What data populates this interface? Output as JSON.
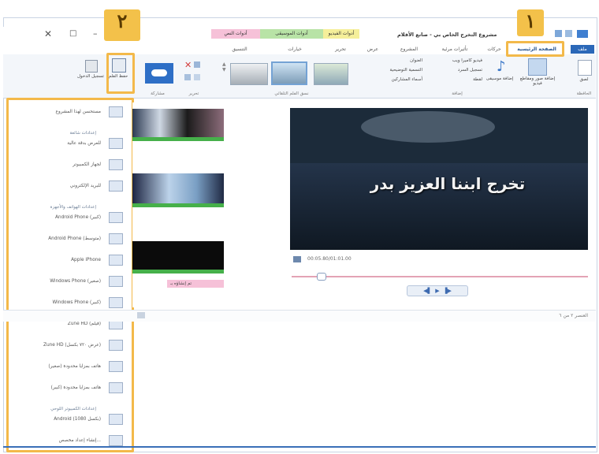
{
  "window": {
    "title": "مشروع التخرج الخاص بي - صانع الأفلام",
    "controls": [
      "x",
      "□",
      "-"
    ]
  },
  "ribbon_tabs": [
    "ملف",
    "الصفحة الرئيسية",
    "حركات",
    "تأثيرات مرئية",
    "المشروع",
    "عرض",
    "تحرير",
    "خيارات",
    "التنسيق"
  ],
  "context_tabs": [
    "أدوات الفيديو",
    "أدوات الموسيقى",
    "أدوات النص"
  ],
  "ribbon": {
    "paste_label": "لصق",
    "add_video_label": "إضافة صور ومقاطع فيديو",
    "add_music_label": "إضافة موسيقى",
    "webcam_label": "فيديو كاميرا ويب",
    "narration_label": "تسجيل السرد",
    "snapshot_label": "لقطة",
    "title_label": "العنوان",
    "caption_label": "التسمية التوضيحية",
    "credits_label": "أسماء المشاركين",
    "save_movie_label": "حفظ الفلم",
    "sign_in_label": "تسجيل الدخول",
    "groups": {
      "clipboard": "الحافظة",
      "add": "إضافة",
      "themes": "نسق الفلم التلقائي",
      "edit": "تحرير",
      "share": "مشاركة"
    }
  },
  "annotations": {
    "badge_1": "١",
    "badge_2": "٢"
  },
  "save_menu": {
    "items": [
      {
        "type": "item",
        "label": "مستحسن لهذا المشروع"
      },
      {
        "type": "heading",
        "label": "إعدادات شائعة"
      },
      {
        "type": "item",
        "label": "للعرض بدقة عالية"
      },
      {
        "type": "item",
        "label": "لجهاز الكمبيوتر"
      },
      {
        "type": "item",
        "label": "للبريد الإلكتروني"
      },
      {
        "type": "heading",
        "label": "إعدادات الهواتف والأجهزة"
      },
      {
        "type": "item",
        "label": "Android Phone (كبير)"
      },
      {
        "type": "item",
        "label": "Android Phone (متوسط)"
      },
      {
        "type": "item",
        "label": "Apple iPhone"
      },
      {
        "type": "item",
        "label": "Windows Phone (صغير)"
      },
      {
        "type": "item",
        "label": "Windows Phone (كبير)"
      },
      {
        "type": "item",
        "label": "Zune HD (فيلم)"
      },
      {
        "type": "item",
        "label": "Zune HD (عرض ٧٢٠ بكسل)"
      },
      {
        "type": "item",
        "label": "هاتف بمزايا محدودة (صغير)"
      },
      {
        "type": "item",
        "label": "هاتف بمزايا محدودة (كبير)"
      },
      {
        "type": "heading",
        "label": "إعدادات الكمبيوتر اللوحي"
      },
      {
        "type": "item",
        "label": "Android (1080 بكسل)"
      },
      {
        "type": "item",
        "label": "إنشاء إعداد مخصص..."
      }
    ]
  },
  "storyboard": {
    "caption_clip_label": "تم إنشاؤه بـ"
  },
  "preview": {
    "overlay_text": "تخرج ابننا العزيز بدر",
    "timecode": "00:05.80/01:01.00"
  },
  "status": {
    "item_count": "العنصر ٢ من ٦"
  },
  "colors": {
    "highlight": "#f3b94a",
    "context_video": "#f5ef9a",
    "context_music": "#b8e3a6",
    "context_text": "#f6c1d8",
    "timeline_green": "#46b04a"
  }
}
